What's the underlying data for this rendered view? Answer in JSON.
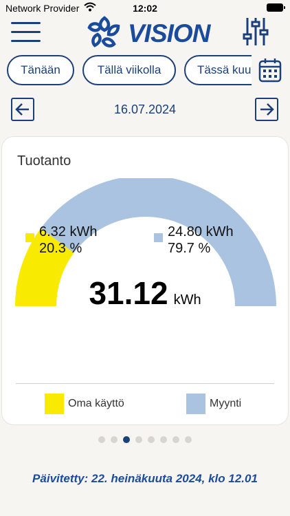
{
  "status_bar": {
    "provider": "Network Provider",
    "time": "12:02"
  },
  "header": {
    "brand": "VISION",
    "menu_icon": "hamburger-icon",
    "filter_icon": "sliders-icon"
  },
  "tabs": [
    {
      "label": "Tänään"
    },
    {
      "label": "Tällä viikolla"
    },
    {
      "label": "Tässä kuussa"
    }
  ],
  "calendar_icon": "calendar-icon",
  "date_nav": {
    "date": "16.07.2024",
    "prev_icon": "arrow-left-icon",
    "next_icon": "arrow-right-icon"
  },
  "card": {
    "title": "Tuotanto",
    "self_use": {
      "value": "6.32 kWh",
      "percent": "20.3 %",
      "fraction": 0.203
    },
    "sold": {
      "value": "24.80 kWh",
      "percent": "79.7 %",
      "fraction": 0.797
    },
    "total_value": "31.12",
    "total_unit": "kWh",
    "legend": [
      {
        "label": "Oma käyttö",
        "color": "#f8ea00"
      },
      {
        "label": "Myynti",
        "color": "#a9c3e0"
      }
    ]
  },
  "pager": {
    "count": 8,
    "active": 2
  },
  "updated_text": "Päivitetty: 22. heinäkuuta 2024, klo 12.01",
  "colors": {
    "primary": "#1b3f7a",
    "self_use": "#f8ea00",
    "sold": "#a9c3e0"
  }
}
